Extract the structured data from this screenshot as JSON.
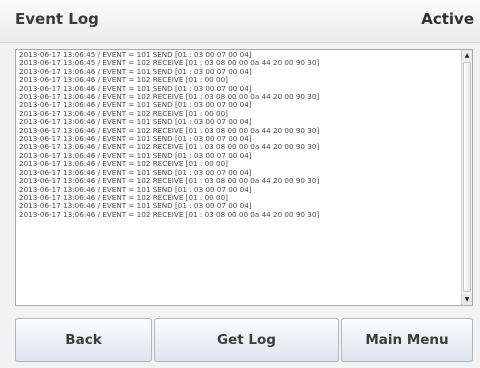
{
  "header": {
    "title": "Event Log",
    "status": "Active"
  },
  "log": {
    "lines": [
      "2013-06-17 13:06:45 / EVENT = 101 SEND [01 : 03 00 07 00 04]",
      "2013-06-17 13:06:45 / EVENT = 102 RECEIVE [01 : 03 08 00 00 0a 44 20 00 90 30]",
      "2013-06-17 13:06:46 / EVENT = 101 SEND [01 : 03 00 07 00 04]",
      "2013-06-17 13:06:46 / EVENT = 102 RECEIVE [01 : 00 00]",
      "2013-06-17 13:06:46 / EVENT = 101 SEND [01 : 03 00 07 00 04]",
      "2013-06-17 13:06:46 / EVENT = 102 RECEIVE [01 : 03 08 00 00 0a 44 20 00 90 30]",
      "2013-06-17 13:06:46 / EVENT = 101 SEND [01 : 03 00 07 00 04]",
      "2013-06-17 13:06:46 / EVENT = 102 RECEIVE [01 : 00 00]",
      "2013-06-17 13:06:46 / EVENT = 101 SEND [01 : 03 00 07 00 04]",
      "2013-06-17 13:06:46 / EVENT = 102 RECEIVE [01 : 03 08 00 00 0a 44 20 00 90 30]",
      "2013-06-17 13:06:46 / EVENT = 101 SEND [01 : 03 00 07 00 04]",
      "2013-06-17 13:06:46 / EVENT = 102 RECEIVE [01 : 03 08 00 00 0a 44 20 00 90 30]",
      "2013-06-17 13:06:46 / EVENT = 101 SEND [01 : 03 00 07 00 04]",
      "2013-06-17 13:06:46 / EVENT = 102 RECEIVE [01 : 00 00]",
      "2013-06-17 13:06:46 / EVENT = 101 SEND [01 : 03 00 07 00 04]",
      "2013-06-17 13:06:46 / EVENT = 102 RECEIVE [01 : 03 08 00 00 0a 44 20 00 90 30]",
      "2013-06-17 13:06:46 / EVENT = 101 SEND [01 : 03 00 07 00 04]",
      "2013-06-17 13:06:46 / EVENT = 102 RECEIVE [01 : 00 00]",
      "2013-06-17 13:06:46 / EVENT = 101 SEND [01 : 03 00 07 00 04]",
      "2013-06-17 13:06:46 / EVENT = 102 RECEIVE [01 : 03 08 00 00 0a 44 20 00 90 30]"
    ]
  },
  "buttons": {
    "back": "Back",
    "get_log": "Get Log",
    "main_menu": "Main Menu"
  },
  "icons": {
    "scroll_up": "scroll-up-arrow",
    "scroll_down": "scroll-down-arrow"
  },
  "colors": {
    "background": "#f2f2f2",
    "log_background": "#ffffff",
    "button_gradient_bottom": "#dce4ee",
    "text": "#3a3a3a"
  }
}
